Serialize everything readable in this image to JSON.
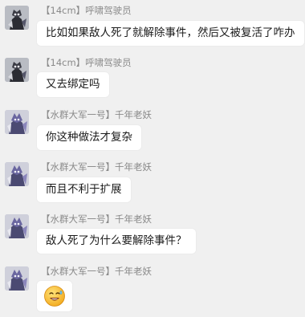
{
  "messages": [
    {
      "sender": "【14cm】呼啸驾驶员",
      "avatar_icon": "dark-character-avatar-icon",
      "text": "比如如果敌人死了就解除事件，然后又被复活了咋办"
    },
    {
      "sender": "【14cm】呼啸驾驶员",
      "avatar_icon": "dark-character-avatar-icon",
      "text": "又去绑定吗"
    },
    {
      "sender": "【水群大军一号】千年老妖",
      "avatar_icon": "purple-character-avatar-icon",
      "text": "你这种做法才复杂"
    },
    {
      "sender": "【水群大军一号】千年老妖",
      "avatar_icon": "purple-character-avatar-icon",
      "text": "而且不利于扩展"
    },
    {
      "sender": "【水群大军一号】千年老妖",
      "avatar_icon": "purple-character-avatar-icon",
      "text": "敌人死了为什么要解除事件？"
    },
    {
      "sender": "【水群大军一号】千年老妖",
      "avatar_icon": "purple-character-avatar-icon",
      "emoji_icon": "sweating-smile-emoji-icon"
    }
  ]
}
